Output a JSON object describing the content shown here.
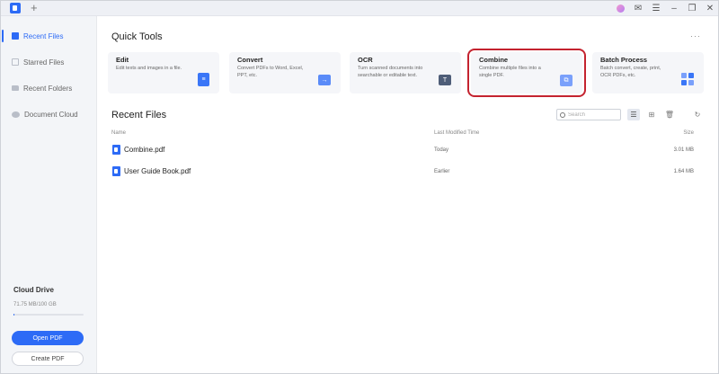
{
  "titlebar": {
    "new_tab": "+",
    "minimize": "–",
    "restore": "❐",
    "close": "✕"
  },
  "sidebar": {
    "items": [
      {
        "label": "Recent Files",
        "icon": "recent-files-icon"
      },
      {
        "label": "Starred Files",
        "icon": "star-icon"
      },
      {
        "label": "Recent Folders",
        "icon": "folder-icon"
      },
      {
        "label": "Document Cloud",
        "icon": "cloud-icon"
      }
    ],
    "cloud_title": "Cloud Drive",
    "cloud_usage": "71.75 MB/100 GB",
    "cloud_used_fraction": 0.0007,
    "open_label": "Open PDF",
    "create_label": "Create PDF"
  },
  "main": {
    "quick_tools_title": "Quick Tools",
    "more": "···",
    "tools": [
      {
        "title": "Edit",
        "desc": "Edit texts and images in a file."
      },
      {
        "title": "Convert",
        "desc": "Convert PDFs to Word, Excel, PPT, etc."
      },
      {
        "title": "OCR",
        "desc": "Turn scanned documents into searchable or editable text."
      },
      {
        "title": "Combine",
        "desc": "Combine multiple files into a single PDF."
      },
      {
        "title": "Batch Process",
        "desc": "Batch convert, create, print, OCR PDFs, etc."
      }
    ],
    "recent_title": "Recent Files",
    "search_placeholder": "Search",
    "columns": {
      "name": "Name",
      "modified": "Last Modified Time",
      "size": "Size"
    },
    "files": [
      {
        "name": "Combine.pdf",
        "modified": "Today",
        "size": "3.01 MB"
      },
      {
        "name": "User Guide Book.pdf",
        "modified": "Earlier",
        "size": "1.64 MB"
      }
    ]
  },
  "colors": {
    "accent": "#2d6bf6",
    "highlight": "#c4232f"
  }
}
